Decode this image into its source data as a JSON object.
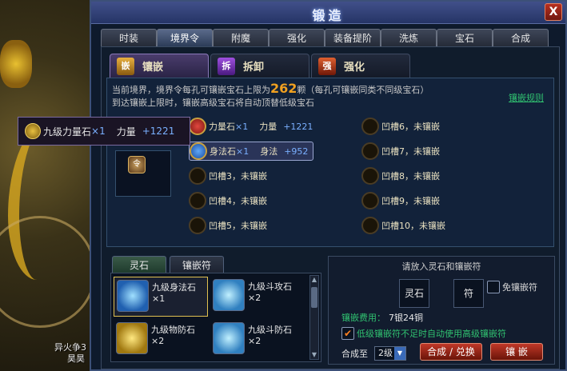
{
  "background": {
    "player_name": "昊昊",
    "player_guild": "异火争3"
  },
  "window": {
    "title": "锻造",
    "close_label": "X"
  },
  "top_tabs": [
    "时装",
    "境界令",
    "附魔",
    "强化",
    "装备提阶",
    "洗炼",
    "宝石",
    "合成"
  ],
  "sub_tabs": [
    {
      "label": "镶嵌",
      "icon": "嵌"
    },
    {
      "label": "拆卸",
      "icon": "拆"
    },
    {
      "label": "强化",
      "icon": "强"
    }
  ],
  "info": {
    "line1_pre": "当前境界，境界令每孔可镶嵌宝石上限为",
    "line1_num": "262",
    "line1_post": "颗（每孔可镶嵌同类不同级宝石）",
    "line2": "到达镶嵌上限时，镶嵌高级宝石将自动顶替低级宝石",
    "rule_link": "镶嵌规则"
  },
  "item": {
    "icon_text": "令"
  },
  "tooltip": {
    "name": "九级力量石",
    "qty": "×1",
    "stat": "力量",
    "value": "+1221"
  },
  "sockets_left": [
    {
      "name": "力量石",
      "qty": "×1",
      "stat": "力量",
      "value": "+1221",
      "filled": "red"
    },
    {
      "name": "身法石",
      "qty": "×1",
      "stat": "身法",
      "value": "+952",
      "filled": "blue"
    },
    {
      "name": "凹槽3，未镶嵌"
    },
    {
      "name": "凹槽4，未镶嵌"
    },
    {
      "name": "凹槽5，未镶嵌"
    }
  ],
  "sockets_right": [
    {
      "name": "凹槽6，未镶嵌"
    },
    {
      "name": "凹槽7，未镶嵌"
    },
    {
      "name": "凹槽8，未镶嵌"
    },
    {
      "name": "凹槽9，未镶嵌"
    },
    {
      "name": "凹槽10，未镶嵌"
    }
  ],
  "gem_tabs": [
    "灵石",
    "镶嵌符"
  ],
  "gems": [
    {
      "name": "九级身法石",
      "qty": "×1",
      "icon": "blue"
    },
    {
      "name": "九级斗攻石",
      "qty": "×2",
      "icon": "cyan"
    },
    {
      "name": "九级物防石",
      "qty": "×2",
      "icon": "gold"
    },
    {
      "name": "九级斗防石",
      "qty": "×2",
      "icon": "cyan"
    }
  ],
  "form": {
    "title": "请放入灵石和镶嵌符",
    "slot_gem": "灵石",
    "slot_charm": "符",
    "free_label": "免镶嵌符",
    "cost_label": "镶嵌费用：",
    "cost_value": "7银24铜",
    "auto_label": "低级镶嵌符不足时自动使用高级镶嵌符",
    "auto_checked": "✔",
    "compose_label": "合成至",
    "compose_level": "2级",
    "compose_button": "合成 / 兑换",
    "embed_button": "镶  嵌"
  }
}
